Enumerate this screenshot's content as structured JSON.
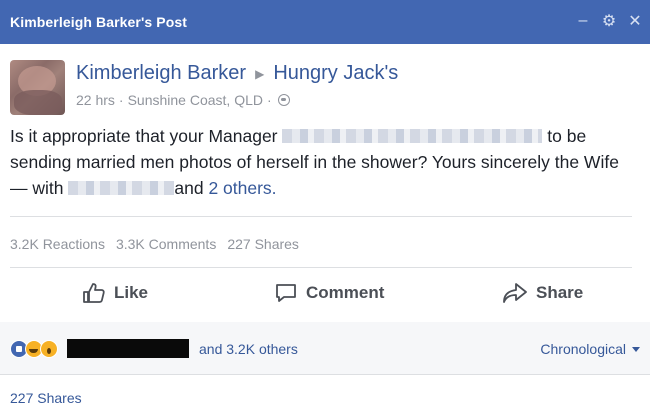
{
  "window": {
    "title": "Kimberleigh Barker's Post",
    "controls": [
      {
        "icon": "minimize-icon",
        "glyph": "–"
      },
      {
        "icon": "gear-icon",
        "glyph": "⚙"
      },
      {
        "icon": "close-icon",
        "glyph": "✕"
      }
    ]
  },
  "post": {
    "author": "Kimberleigh Barker",
    "target": "Hungry Jack's",
    "time": "22 hrs",
    "location": "Sunshine Coast, QLD",
    "separator": "·",
    "privacy_icon": "globe-icon",
    "text": {
      "part1": "Is it appropriate that your Manager",
      "part2": "to be sending married men photos of herself in the shower? Yours sincerely the Wife — with",
      "part3": "and",
      "others_link": "2 others."
    }
  },
  "stats": {
    "reactions": "3.2K Reactions",
    "comments": "3.3K Comments",
    "shares": "227 Shares"
  },
  "actions": [
    {
      "label": "Like",
      "icon": "thumbs-up-icon"
    },
    {
      "label": "Comment",
      "icon": "comment-icon"
    },
    {
      "label": "Share",
      "icon": "share-arrow-icon"
    }
  ],
  "summary": {
    "reaction_icons": [
      "like",
      "haha",
      "wow"
    ],
    "others_text": "and 3.2K others",
    "sort_label": "Chronological"
  },
  "shares_link": "227 Shares",
  "colors": {
    "header": "#4267b2",
    "link": "#365899",
    "muted": "#90949c"
  }
}
